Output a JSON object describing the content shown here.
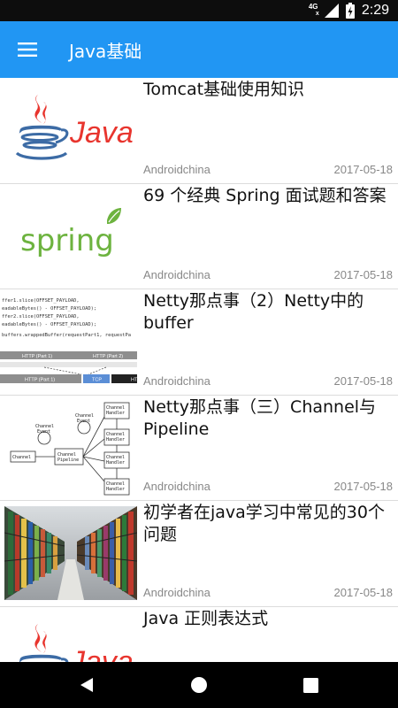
{
  "status_bar": {
    "network": "4G",
    "time": "2:29"
  },
  "app_bar": {
    "title": "Java基础",
    "menu_icon": "hamburger-menu-icon"
  },
  "articles": [
    {
      "title": "Tomcat基础使用知识",
      "author": "Androidchina",
      "date": "2017-05-18",
      "thumbnail": "java-logo"
    },
    {
      "title": "69 个经典 Spring 面试题和答案",
      "author": "Androidchina",
      "date": "2017-05-18",
      "thumbnail": "spring-logo"
    },
    {
      "title": "Netty那点事（2）Netty中的buffer",
      "author": "Androidchina",
      "date": "2017-05-18",
      "thumbnail": "netty-buffer-code"
    },
    {
      "title": "Netty那点事（三）Channel与Pipeline",
      "author": "Androidchina",
      "date": "2017-05-18",
      "thumbnail": "channel-pipeline-diagram"
    },
    {
      "title": "初学者在java学习中常见的30个问题",
      "author": "Androidchina",
      "date": "2017-05-18",
      "thumbnail": "library-photo"
    },
    {
      "title": "Java 正则表达式",
      "author": "",
      "date": "",
      "thumbnail": "java-logo"
    }
  ],
  "thumb_text": {
    "java": "Java",
    "spring": "spring",
    "netty_code": [
      "ffer1.slice(OFFSET_PAYLOAD,",
      "eadableBytes() - OFFSET_PAYLOAD);",
      "ffer2.slice(OFFSET_PAYLOAD,",
      "eadableBytes() - OFFSET_PAYLOAD);",
      "buffers.wrappedBuffer(requestPart1, requestPa"
    ],
    "http_part1": "HTTP (Part 1)",
    "http_part2": "HTTP (Part 2)",
    "tcp": "TCP",
    "ht": "HT",
    "channel_event": "Channel Event",
    "channel": "Channel",
    "channel_pipeline": "Channel Pipeline",
    "channel_handler": "Channel Handler"
  },
  "nav_bar": {
    "back_icon": "back-triangle-icon",
    "home_icon": "home-circle-icon",
    "recent_icon": "recent-apps-square-icon"
  },
  "colors": {
    "primary": "#2196f3",
    "status_bar": "#0d0d0d",
    "nav_bar": "#000000",
    "java_red": "#e8352e",
    "java_blue": "#3c6ba5",
    "spring_green": "#6db33f",
    "meta_text": "#888888"
  }
}
